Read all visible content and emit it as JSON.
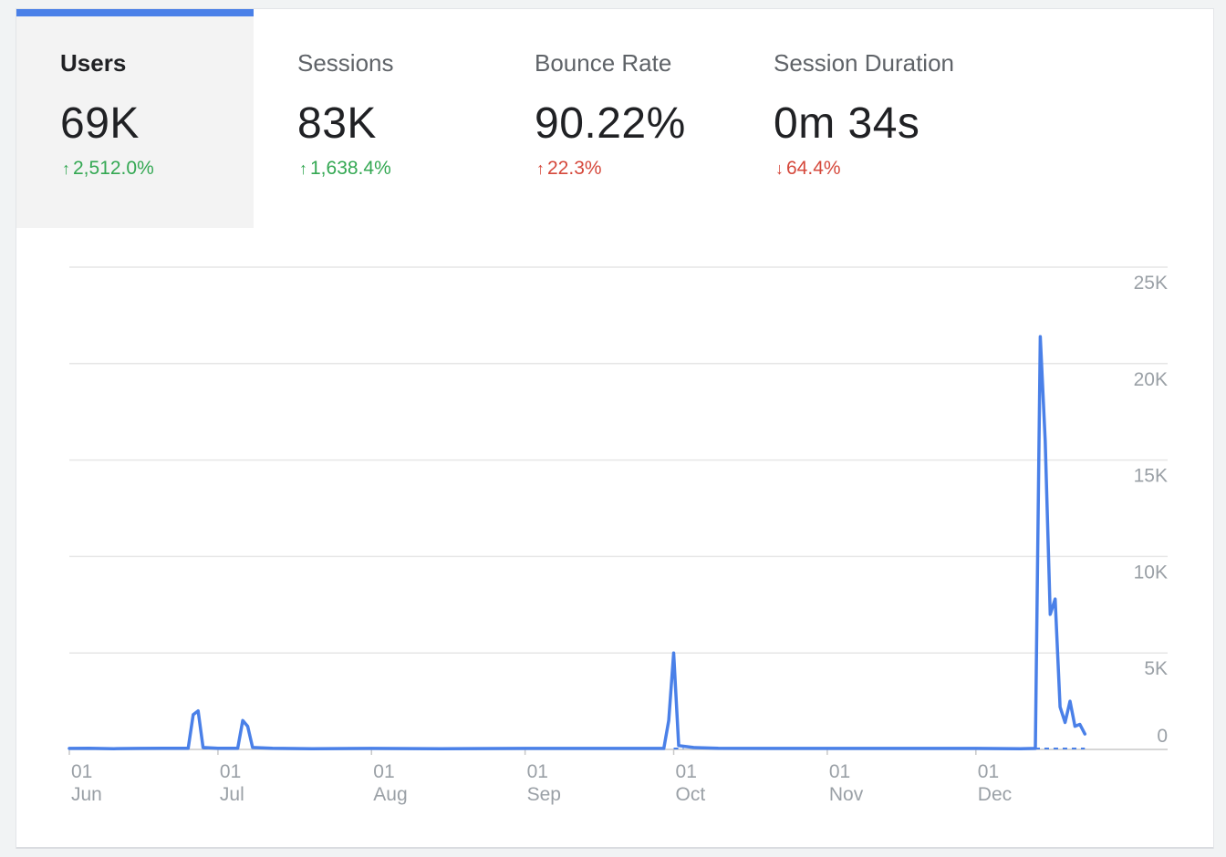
{
  "metrics": [
    {
      "title": "Users",
      "value": "69K",
      "arrow": "↑",
      "delta": "2,512.0%",
      "status": "good",
      "active": true
    },
    {
      "title": "Sessions",
      "value": "83K",
      "arrow": "↑",
      "delta": "1,638.4%",
      "status": "good",
      "active": false
    },
    {
      "title": "Bounce Rate",
      "value": "90.22%",
      "arrow": "↑",
      "delta": "22.3%",
      "status": "bad",
      "active": false
    },
    {
      "title": "Session Duration",
      "value": "0m 34s",
      "arrow": "↓",
      "delta": "64.4%",
      "status": "bad",
      "active": false
    }
  ],
  "colors": {
    "accent": "#4a80e8",
    "line": "#4a80e8",
    "good": "#34a853",
    "bad": "#d5483b",
    "grid": "#e6e6e6"
  },
  "chart_data": {
    "type": "line",
    "x_axis": {
      "start": "2023-06-01",
      "end": "2023-12-27",
      "ticks": [
        {
          "date": "2023-06-01",
          "day": "01",
          "month": "Jun"
        },
        {
          "date": "2023-07-01",
          "day": "01",
          "month": "Jul"
        },
        {
          "date": "2023-08-01",
          "day": "01",
          "month": "Aug"
        },
        {
          "date": "2023-09-01",
          "day": "01",
          "month": "Sep"
        },
        {
          "date": "2023-10-01",
          "day": "01",
          "month": "Oct"
        },
        {
          "date": "2023-11-01",
          "day": "01",
          "month": "Nov"
        },
        {
          "date": "2023-12-01",
          "day": "01",
          "month": "Dec"
        }
      ]
    },
    "y_axis": {
      "min": 0,
      "max": 25000,
      "ticks": [
        0,
        5000,
        10000,
        15000,
        20000,
        25000
      ],
      "tick_labels": [
        "0",
        "5K",
        "10K",
        "15K",
        "20K",
        "25K"
      ],
      "position": "right"
    },
    "grid": true,
    "series": [
      {
        "name": "Users",
        "points": [
          [
            "2023-06-01",
            50
          ],
          [
            "2023-06-05",
            60
          ],
          [
            "2023-06-10",
            40
          ],
          [
            "2023-06-15",
            50
          ],
          [
            "2023-06-20",
            60
          ],
          [
            "2023-06-25",
            60
          ],
          [
            "2023-06-26",
            1800
          ],
          [
            "2023-06-27",
            2000
          ],
          [
            "2023-06-28",
            100
          ],
          [
            "2023-07-01",
            60
          ],
          [
            "2023-07-05",
            60
          ],
          [
            "2023-07-06",
            1500
          ],
          [
            "2023-07-07",
            1200
          ],
          [
            "2023-07-08",
            100
          ],
          [
            "2023-07-12",
            60
          ],
          [
            "2023-07-20",
            40
          ],
          [
            "2023-08-01",
            50
          ],
          [
            "2023-08-15",
            40
          ],
          [
            "2023-09-01",
            50
          ],
          [
            "2023-09-15",
            50
          ],
          [
            "2023-09-29",
            50
          ],
          [
            "2023-09-30",
            1500
          ],
          [
            "2023-10-01",
            5000
          ],
          [
            "2023-10-02",
            200
          ],
          [
            "2023-10-05",
            100
          ],
          [
            "2023-10-10",
            60
          ],
          [
            "2023-10-20",
            50
          ],
          [
            "2023-11-01",
            50
          ],
          [
            "2023-11-15",
            50
          ],
          [
            "2023-12-01",
            50
          ],
          [
            "2023-12-10",
            40
          ],
          [
            "2023-12-13",
            50
          ],
          [
            "2023-12-14",
            21400
          ],
          [
            "2023-12-15",
            16000
          ],
          [
            "2023-12-16",
            7000
          ],
          [
            "2023-12-17",
            7800
          ],
          [
            "2023-12-18",
            2200
          ],
          [
            "2023-12-19",
            1400
          ],
          [
            "2023-12-20",
            2500
          ],
          [
            "2023-12-21",
            1200
          ],
          [
            "2023-12-22",
            1300
          ],
          [
            "2023-12-23",
            800
          ]
        ]
      }
    ],
    "projection_segments": [
      {
        "from": "2023-06-28",
        "to": "2023-06-30"
      },
      {
        "from": "2023-10-01",
        "to": "2023-10-03"
      },
      {
        "from": "2023-12-13",
        "to": "2023-12-23"
      }
    ]
  }
}
